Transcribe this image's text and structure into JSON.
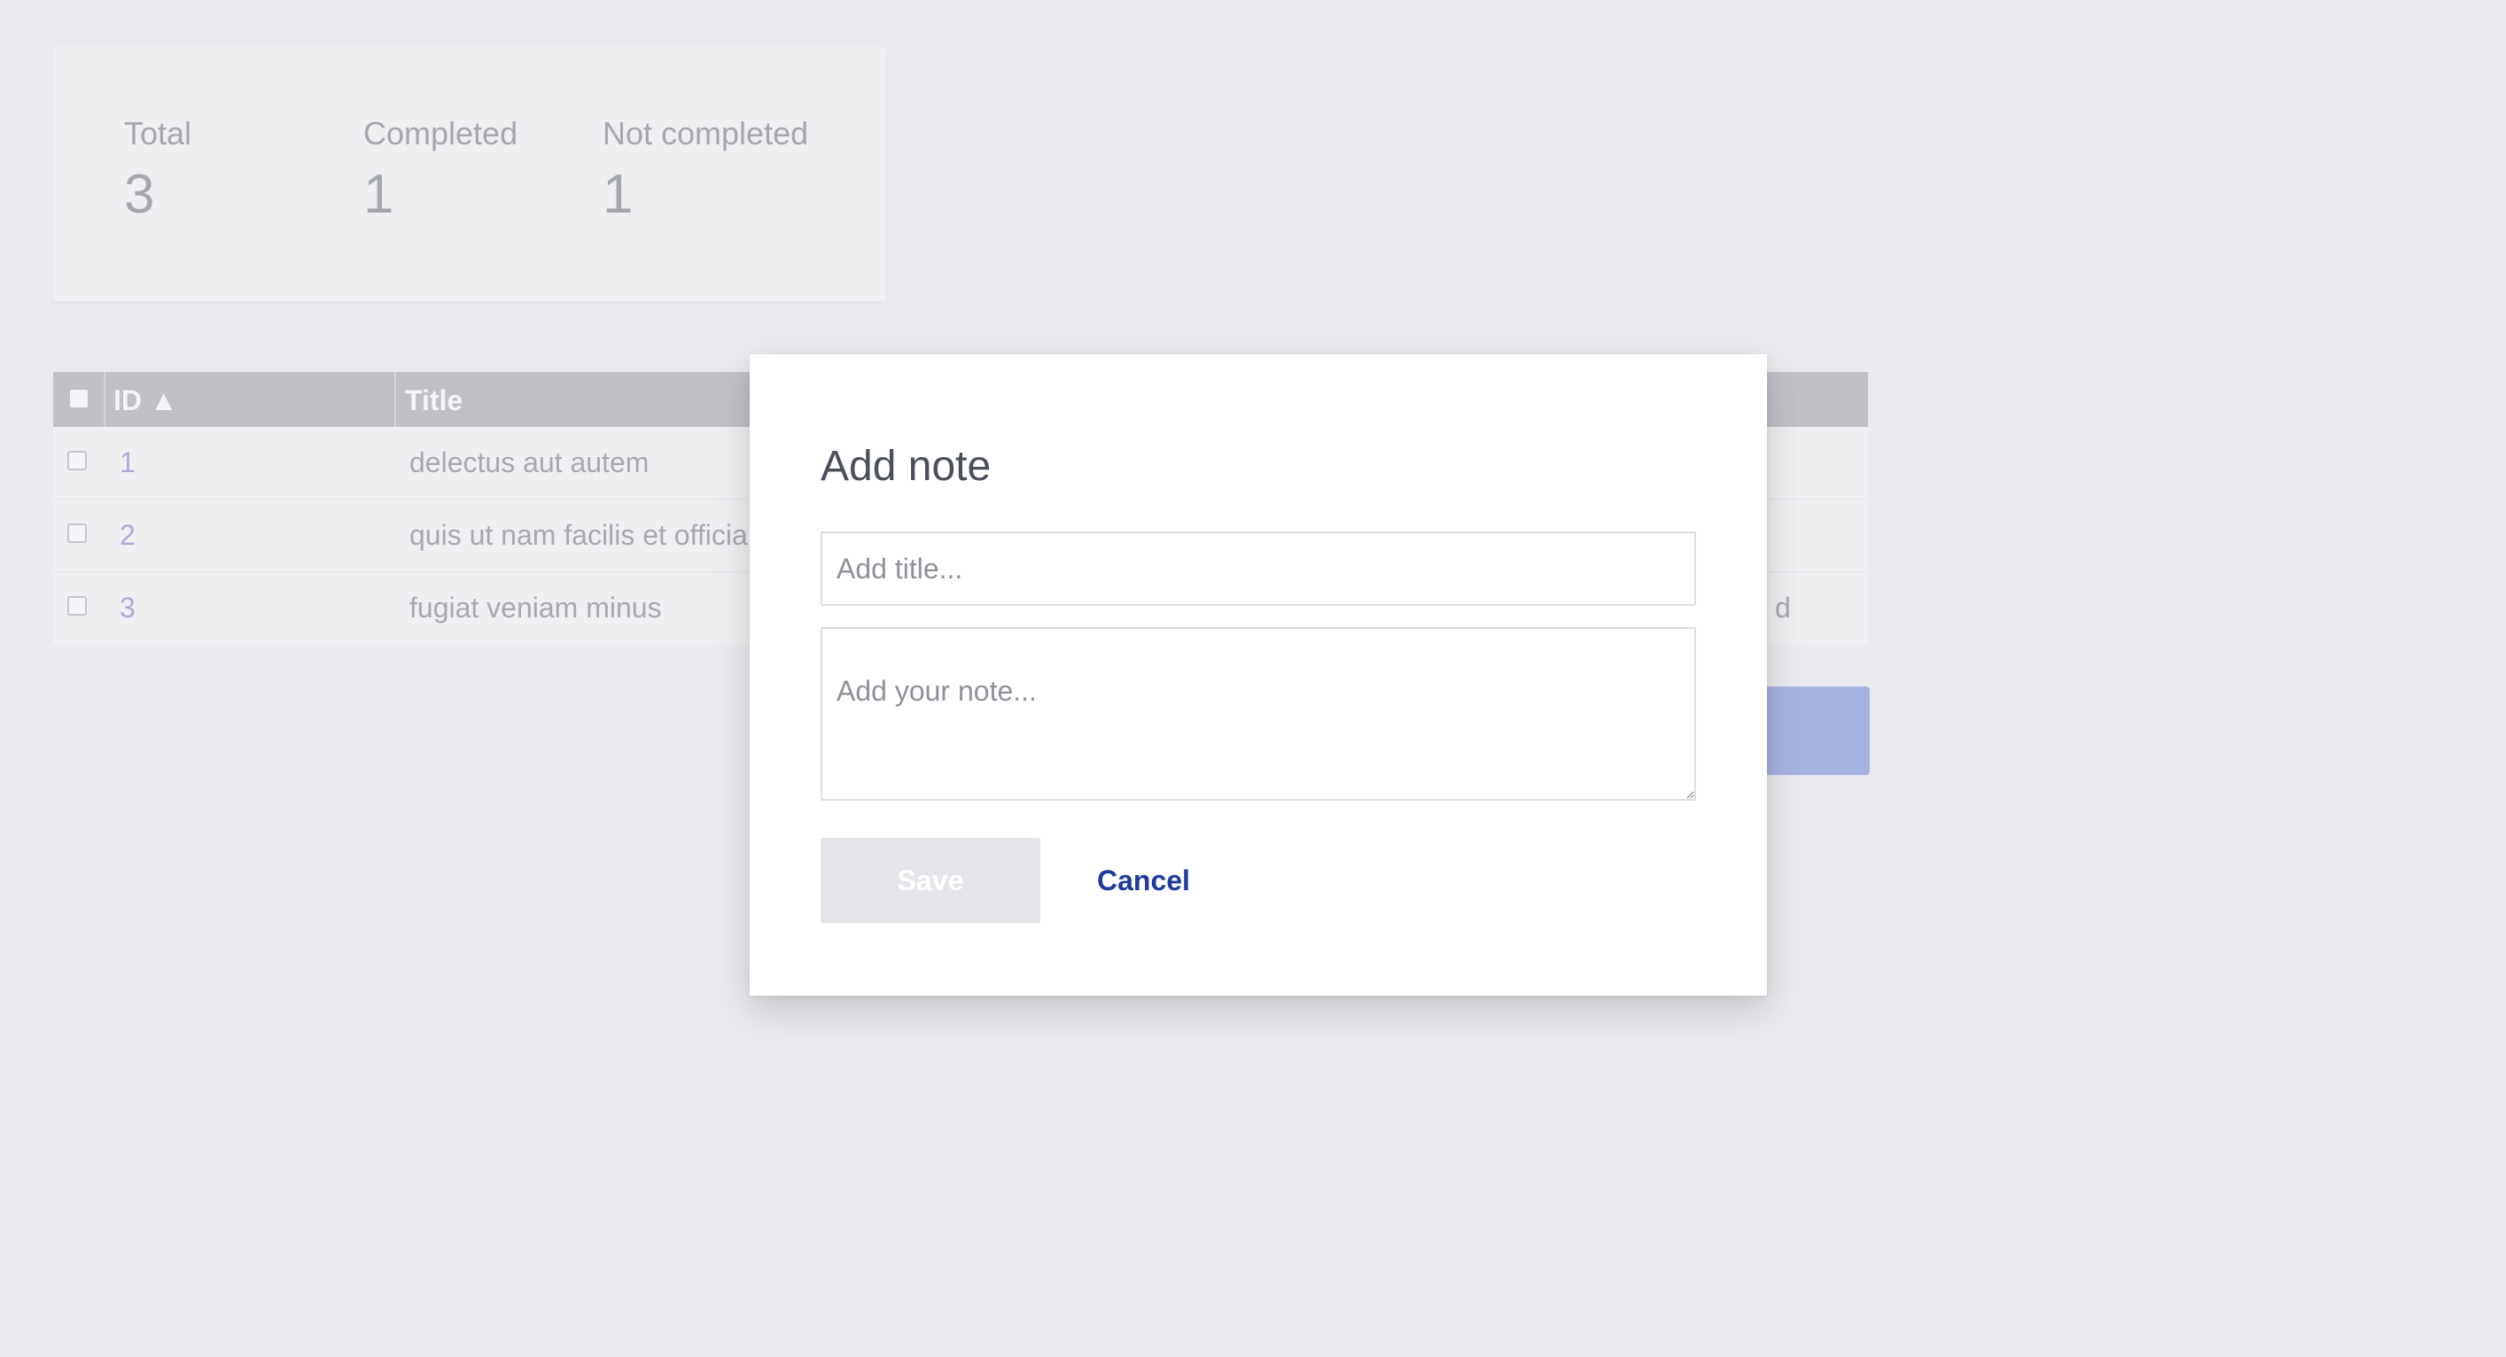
{
  "stats": {
    "total_label": "Total",
    "total_value": "3",
    "completed_label": "Completed",
    "completed_value": "1",
    "not_completed_label": "Not completed",
    "not_completed_value": "1"
  },
  "table": {
    "columns": {
      "id": "ID ▲",
      "title": "Title"
    },
    "rows": [
      {
        "id": "1",
        "title": "delectus aut autem",
        "right": ""
      },
      {
        "id": "2",
        "title": "quis ut nam facilis et officia qui",
        "right": ""
      },
      {
        "id": "3",
        "title": "fugiat veniam minus",
        "right": "d"
      }
    ]
  },
  "modal": {
    "title": "Add note",
    "title_placeholder": "Add title...",
    "note_placeholder": "Add your note...",
    "save_label": "Save",
    "cancel_label": "Cancel"
  },
  "colors": {
    "background": "#e9eaee",
    "accent": "#1f3a9e",
    "link": "#a9abdb",
    "table_header": "#bfc1c7"
  }
}
